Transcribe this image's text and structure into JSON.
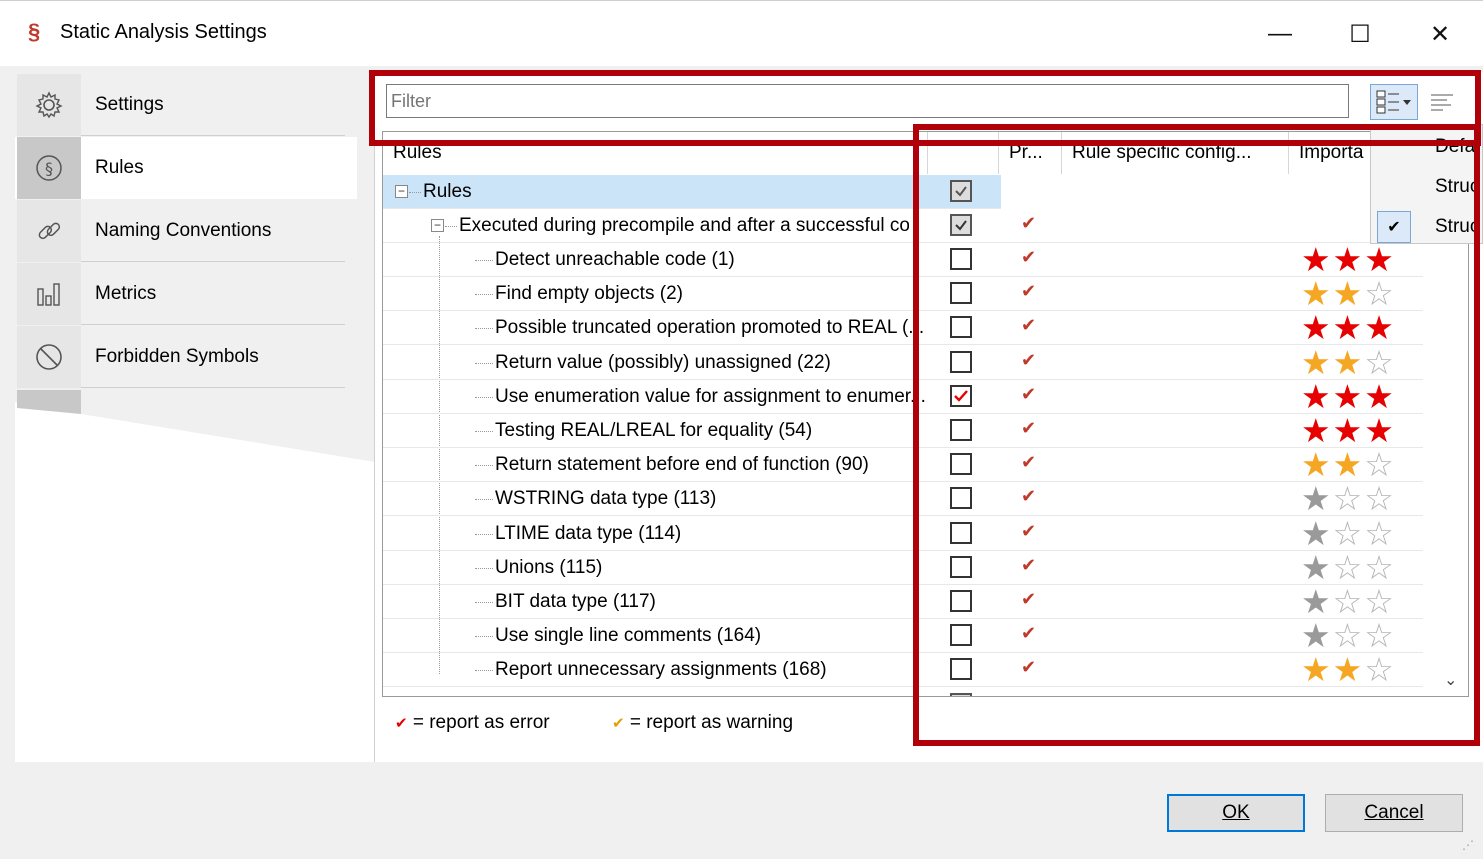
{
  "window": {
    "title": "Static Analysis Settings",
    "icon_glyph": "§",
    "minimize_glyph": "—",
    "maximize_glyph": "☐",
    "close_glyph": "✕"
  },
  "sidebar": {
    "items": [
      {
        "label": "Settings",
        "icon": "gear-icon"
      },
      {
        "label": "Rules",
        "icon": "paragraph-icon",
        "selected": true
      },
      {
        "label": "Naming Conventions",
        "icon": "link-icon"
      },
      {
        "label": "Metrics",
        "icon": "bar-chart-icon"
      },
      {
        "label": "Forbidden Symbols",
        "icon": "forbidden-icon"
      }
    ]
  },
  "filter": {
    "placeholder": "Filter"
  },
  "columns": [
    "Rules",
    "",
    "Pr...",
    "Rule specific config...",
    "Importa"
  ],
  "tree": {
    "root_label": "Rules",
    "group_label": "Executed during precompile and after a successful co",
    "rows": [
      {
        "label": "Detect unreachable code (1)",
        "checked": false,
        "stars": 3,
        "star_color": "red"
      },
      {
        "label": "Find empty objects (2)",
        "checked": false,
        "stars": 2,
        "star_color": "orange"
      },
      {
        "label": "Possible truncated operation promoted to REAL (...",
        "checked": false,
        "stars": 3,
        "star_color": "red"
      },
      {
        "label": "Return value (possibly) unassigned (22)",
        "checked": false,
        "stars": 2,
        "star_color": "orange"
      },
      {
        "label": "Use enumeration value for assignment to enumer...",
        "checked": true,
        "stars": 3,
        "star_color": "red"
      },
      {
        "label": "Testing REAL/LREAL for equality (54)",
        "checked": false,
        "stars": 3,
        "star_color": "red"
      },
      {
        "label": "Return statement before end of function (90)",
        "checked": false,
        "stars": 2,
        "star_color": "orange"
      },
      {
        "label": "WSTRING data type (113)",
        "checked": false,
        "stars": 1,
        "star_color": "grey"
      },
      {
        "label": "LTIME data type (114)",
        "checked": false,
        "stars": 1,
        "star_color": "grey"
      },
      {
        "label": "Unions (115)",
        "checked": false,
        "stars": 1,
        "star_color": "grey"
      },
      {
        "label": "BIT data type (117)",
        "checked": false,
        "stars": 1,
        "star_color": "grey"
      },
      {
        "label": "Use single line comments (164)",
        "checked": false,
        "stars": 1,
        "star_color": "grey"
      },
      {
        "label": "Report unnecessary assignments (168)",
        "checked": false,
        "stars": 2,
        "star_color": "orange"
      }
    ]
  },
  "dropdown": {
    "items": [
      {
        "label": "Defa",
        "checked": false
      },
      {
        "label": "Struc",
        "checked": false
      },
      {
        "label": "Struc",
        "checked": true
      }
    ]
  },
  "legend": {
    "error_glyph": "✔",
    "error_text": "= report as error",
    "warning_glyph": "✔",
    "warning_text": "= report as warning"
  },
  "buttons": {
    "ok": "OK",
    "cancel": "Cancel"
  },
  "colors": {
    "highlight": "#b0000a",
    "error_tick": "#e60000",
    "warning_tick": "#e0a000",
    "star_red": "#e60000",
    "star_orange": "#f5a623",
    "star_grey": "#9a9a9a",
    "selection": "#cce4f7"
  }
}
